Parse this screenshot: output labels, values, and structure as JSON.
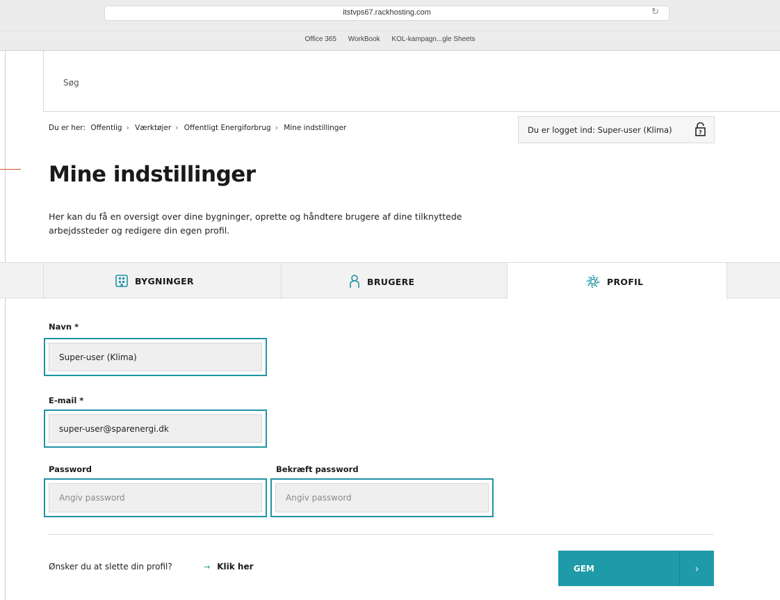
{
  "browser": {
    "url": "itstvps67.rackhosting.com",
    "bookmarks": [
      "Office 365",
      "WorkBook",
      "KOL-kampagn...gle Sheets"
    ]
  },
  "header": {
    "search_label": "Søg"
  },
  "breadcrumb": {
    "prefix": "Du er her:",
    "items": [
      "Offentlig",
      "Værktøjer",
      "Offentligt Energiforbrug",
      "Mine indstillinger"
    ]
  },
  "login_status": "Du er logget ind: Super-user (Klima)",
  "page": {
    "title": "Mine indstillinger",
    "intro": "Her kan du få en oversigt over dine bygninger, oprette og håndtere brugere af dine tilknyttede arbejdssteder og redigere din egen profil."
  },
  "tabs": [
    {
      "label": "BYGNINGER",
      "icon": "building-icon"
    },
    {
      "label": "BRUGERE",
      "icon": "user-icon"
    },
    {
      "label": "PROFIL",
      "icon": "gear-icon",
      "active": true
    }
  ],
  "form": {
    "name": {
      "label": "Navn *",
      "value": "Super-user (Klima)"
    },
    "email": {
      "label": "E-mail *",
      "value": "super-user@sparenergi.dk"
    },
    "password": {
      "label": "Password",
      "placeholder": "Angiv password"
    },
    "confirm_password": {
      "label": "Bekræft password",
      "placeholder": "Angiv password"
    }
  },
  "footer": {
    "delete_question": "Ønsker du at slette din profil?",
    "delete_link": "Klik her",
    "save_label": "GEM"
  },
  "colors": {
    "accent": "#1e9aa8",
    "focus_border": "#1e93a3",
    "marker": "#d8542f"
  }
}
